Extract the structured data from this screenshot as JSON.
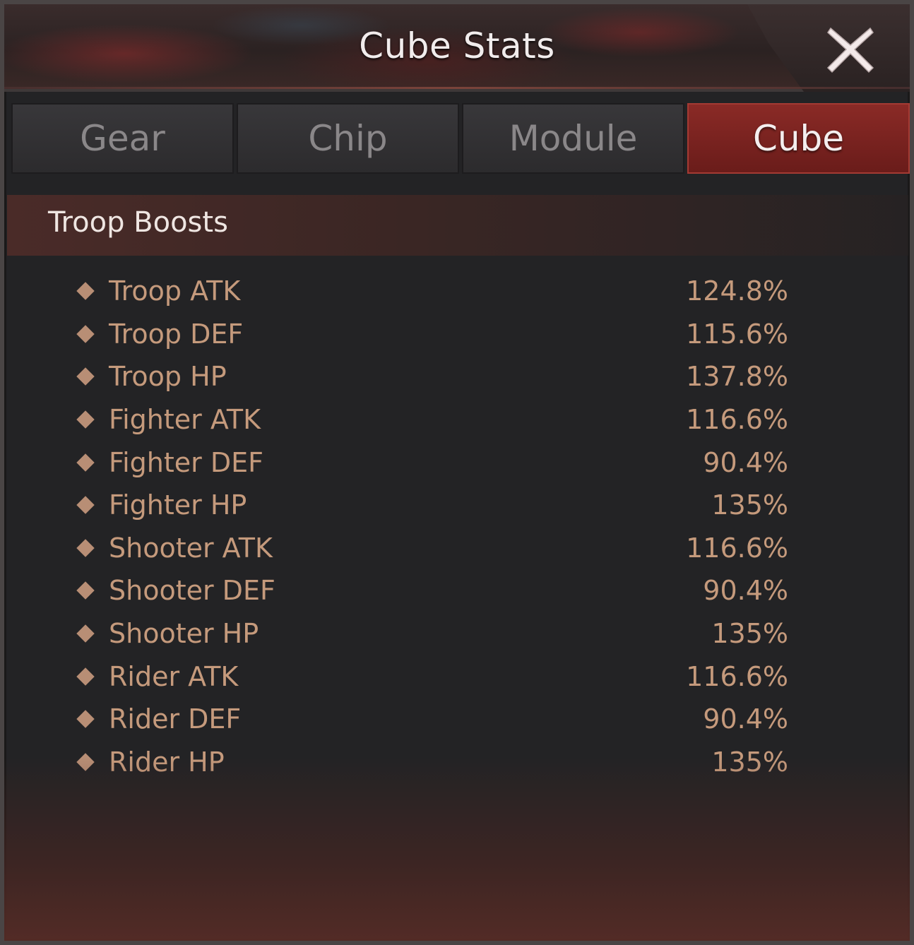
{
  "window": {
    "title": "Cube Stats"
  },
  "tabs": [
    {
      "label": "Gear",
      "active": false
    },
    {
      "label": "Chip",
      "active": false
    },
    {
      "label": "Module",
      "active": false
    },
    {
      "label": "Cube",
      "active": true
    }
  ],
  "section": {
    "title": "Troop Boosts"
  },
  "stats": [
    {
      "label": "Troop ATK",
      "value": "124.8%"
    },
    {
      "label": "Troop DEF",
      "value": "115.6%"
    },
    {
      "label": "Troop HP",
      "value": "137.8%"
    },
    {
      "label": "Fighter ATK",
      "value": "116.6%"
    },
    {
      "label": "Fighter DEF",
      "value": "90.4%"
    },
    {
      "label": "Fighter HP",
      "value": "135%"
    },
    {
      "label": "Shooter ATK",
      "value": "116.6%"
    },
    {
      "label": "Shooter DEF",
      "value": "90.4%"
    },
    {
      "label": "Shooter HP",
      "value": "135%"
    },
    {
      "label": "Rider ATK",
      "value": "116.6%"
    },
    {
      "label": "Rider DEF",
      "value": "90.4%"
    },
    {
      "label": "Rider HP",
      "value": "135%"
    }
  ],
  "icons": {
    "close": "close-x-icon",
    "bullet": "diamond-bullet-icon"
  },
  "colors": {
    "accent": "#8a2a26",
    "stat_text": "#c59a7c",
    "panel_bg": "#232325"
  }
}
